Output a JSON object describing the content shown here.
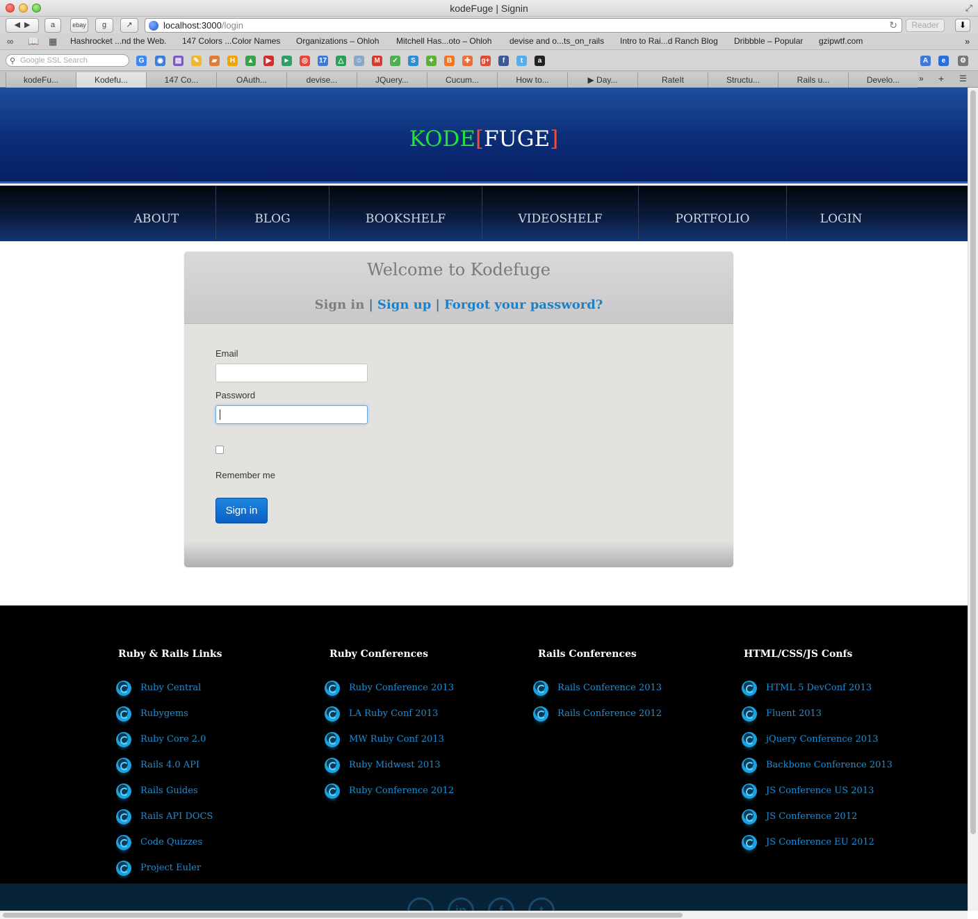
{
  "browser": {
    "window_title": "kodeFuge | Signin",
    "url_host": "localhost:3000",
    "url_path": "/login",
    "reader_label": "Reader",
    "search_placeholder": "Google SSL Search",
    "toolbar_buttons": [
      "ebay"
    ],
    "bookmarks": [
      "Hashrocket ...nd the Web.",
      "147 Colors ...Color Names",
      "Organizations – Ohloh",
      "Mitchell Has...oto – Ohloh",
      "devise and o...ts_on_rails",
      "Intro to Rai...d Ranch Blog",
      "Dribbble – Popular",
      "gzipwtf.com"
    ],
    "tabs": [
      "kodeFu...",
      "Kodefu...",
      "147 Co...",
      "OAuth...",
      "devise...",
      "JQuery...",
      "Cucum...",
      "How to...",
      "▶ Day...",
      "RateIt",
      "Structu...",
      "Rails u...",
      "Develo..."
    ],
    "active_tab": 1
  },
  "site": {
    "logo": {
      "kode": "KODE",
      "open": "[",
      "fuge": "FUGE",
      "close": "]"
    },
    "nav": [
      "ABOUT",
      "BLOG",
      "BOOKSHELF",
      "VIDEOSHELF",
      "PORTFOLIO",
      "LOGIN"
    ]
  },
  "login": {
    "title": "Welcome to Kodefuge",
    "current": "Sign in",
    "signup": "Sign up",
    "forgot": "Forgot your password?",
    "sep": "|",
    "email_label": "Email",
    "email_value": "",
    "password_label": "Password",
    "password_value": "",
    "remember_label": "Remember me",
    "remember_checked": false,
    "submit": "Sign in"
  },
  "footer": {
    "columns": [
      {
        "title": "Ruby & Rails Links",
        "links": [
          "Ruby Central",
          "Rubygems",
          "Ruby Core 2.0",
          "Rails 4.0 API",
          "Rails Guides",
          "Rails API DOCS",
          "Code Quizzes",
          "Project Euler"
        ]
      },
      {
        "title": "Ruby Conferences",
        "links": [
          "Ruby Conference 2013",
          "LA Ruby Conf 2013",
          "MW Ruby Conf 2013",
          "Ruby Midwest 2013",
          "Ruby Conference 2012"
        ]
      },
      {
        "title": "Rails Conferences",
        "links": [
          "Rails Conference 2013",
          "Rails Conference 2012"
        ]
      },
      {
        "title": "HTML/CSS/JS Confs",
        "links": [
          "HTML 5 DevConf 2013",
          "Fluent 2013",
          "jQuery Conference 2013",
          "Backbone Conference 2013",
          "JS Conference US 2013",
          "JS Conference 2012",
          "JS Conference EU 2012"
        ]
      }
    ],
    "social": [
      "github-icon",
      "linkedin-icon",
      "facebook-icon",
      "twitter-icon"
    ]
  },
  "colors": {
    "brand_green": "#26e03a",
    "brand_bracket": "#ff4a2a",
    "link_blue": "#1a82c9",
    "button_blue": "#0d5fc3"
  }
}
